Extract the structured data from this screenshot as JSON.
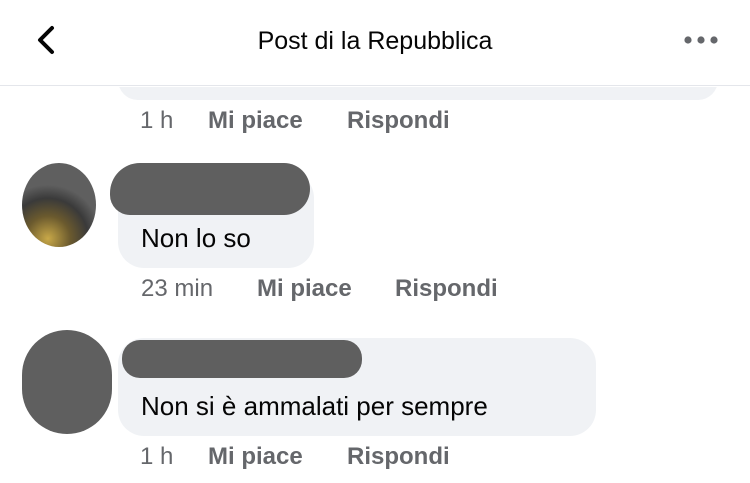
{
  "header": {
    "title": "Post di la Repubblica",
    "back_icon": "chevron-left-icon",
    "more_icon": "more-horizontal-icon"
  },
  "comments": [
    {
      "time": "1 h",
      "like_label": "Mi piace",
      "reply_label": "Rispondi"
    },
    {
      "text": "Non lo so",
      "time": "23 min",
      "like_label": "Mi piace",
      "reply_label": "Rispondi"
    },
    {
      "text": "Non si è ammalati per sempre",
      "time": "1 h",
      "like_label": "Mi piace",
      "reply_label": "Rispondi"
    }
  ],
  "colors": {
    "bubble": "#f0f2f5",
    "meta_text": "#65676b",
    "text": "#050505"
  }
}
